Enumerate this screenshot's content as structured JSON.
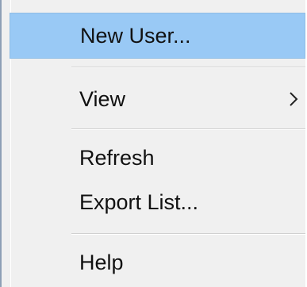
{
  "context_menu": {
    "items": [
      {
        "label": "New User...",
        "highlighted": true
      },
      {
        "label": "View",
        "has_submenu": true
      },
      {
        "label": "Refresh"
      },
      {
        "label": "Export List..."
      },
      {
        "label": "Help"
      }
    ]
  },
  "colors": {
    "highlight": "#99c9f5",
    "menu_background": "#f0f0f0",
    "left_border": "#8ea0b6"
  }
}
